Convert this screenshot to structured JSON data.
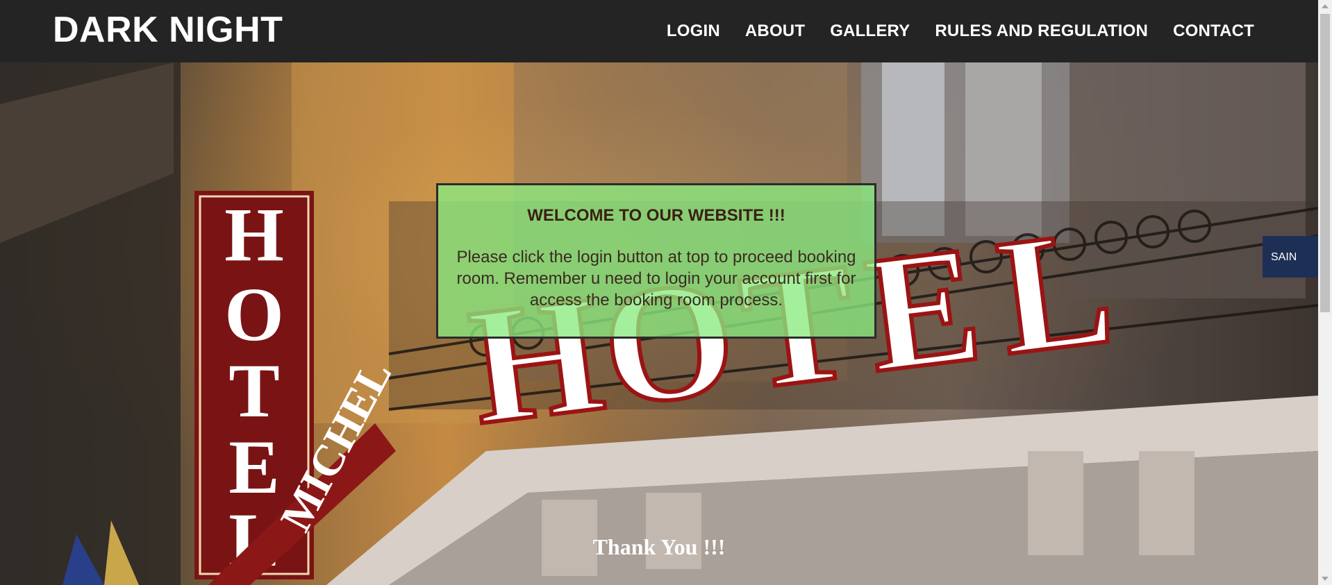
{
  "header": {
    "brand": "DARK NIGHT",
    "nav": [
      {
        "label": "LOGIN"
      },
      {
        "label": "ABOUT"
      },
      {
        "label": "GALLERY"
      },
      {
        "label": "RULES AND REGULATION"
      },
      {
        "label": "CONTACT"
      }
    ]
  },
  "hero": {
    "signs": {
      "vertical_sign": "HOTEL",
      "main_sign": "HOTEL",
      "corner_sign": "MICHEL",
      "side_sign": "SAIN"
    }
  },
  "welcome": {
    "title": "WELCOME TO OUR WEBSITE !!!",
    "message": "Please click the login button at top to proceed booking room. Remember u need to login your account first for access the booking room process."
  },
  "footer": {
    "thanks": "Thank You !!!"
  },
  "colors": {
    "nav_bg": "#242424",
    "panel_bg": "#8aeb80",
    "sign_red": "#7a1414",
    "text_white": "#ffffff"
  }
}
